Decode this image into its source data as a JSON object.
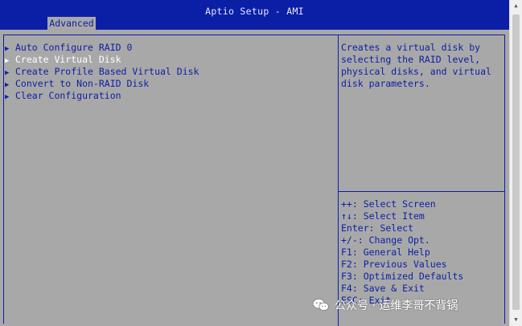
{
  "header": {
    "title": "Aptio Setup - AMI",
    "tabs": [
      {
        "label": "Advanced",
        "active": true
      }
    ]
  },
  "menu": {
    "items": [
      {
        "label": "Auto Configure RAID 0",
        "selected": false
      },
      {
        "label": "Create Virtual Disk",
        "selected": true
      },
      {
        "label": "Create Profile Based Virtual Disk",
        "selected": false
      },
      {
        "label": "Convert to Non-RAID Disk",
        "selected": false
      },
      {
        "label": "Clear Configuration",
        "selected": false
      }
    ]
  },
  "help": {
    "text": "Creates a virtual disk by\nselecting the RAID level,\nphysical disks, and virtual\ndisk parameters."
  },
  "key_legend": [
    "++: Select Screen",
    "↑↓: Select Item",
    "Enter: Select",
    "+/-: Change Opt.",
    "F1: General Help",
    "F2: Previous Values",
    "F3: Optimized Defaults",
    "F4: Save & Exit",
    "ESC: Exit"
  ],
  "watermark": {
    "text": "公众号 · 运维李哥不背锅"
  },
  "colors": {
    "header_bg": "#0a1fa6",
    "body_bg": "#a8a8a8",
    "text": "#0a1fa6",
    "selected_text": "#ffffff"
  },
  "icons": {
    "menu_arrow": "triangle-right-icon",
    "watermark": "wechat-icon"
  }
}
